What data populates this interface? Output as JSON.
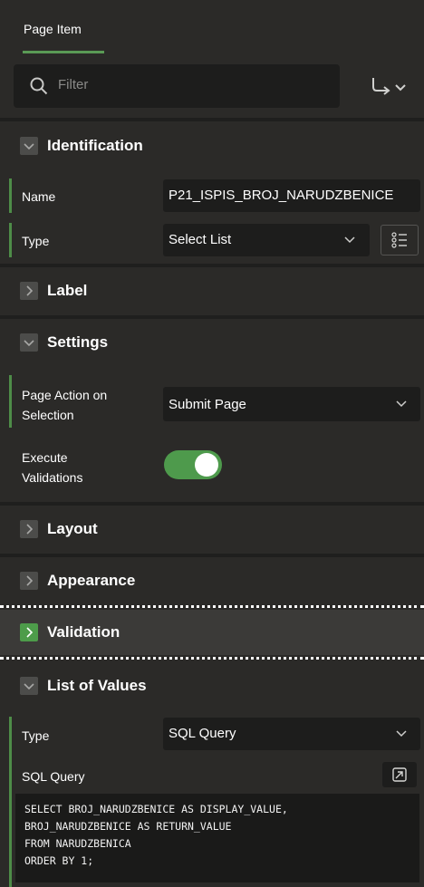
{
  "tab": {
    "label": "Page Item"
  },
  "search": {
    "placeholder": "Filter"
  },
  "sections": {
    "identification": {
      "title": "Identification",
      "name_label": "Name",
      "name_value": "P21_ISPIS_BROJ_NARUDZBENICE",
      "type_label": "Type",
      "type_value": "Select List"
    },
    "label": {
      "title": "Label"
    },
    "settings": {
      "title": "Settings",
      "page_action_label_1": "Page Action on",
      "page_action_label_2": "Selection",
      "page_action_value": "Submit Page",
      "execute_label_1": "Execute",
      "execute_label_2": "Validations",
      "execute_validations_on": true
    },
    "layout": {
      "title": "Layout"
    },
    "appearance": {
      "title": "Appearance"
    },
    "validation": {
      "title": "Validation"
    },
    "lov": {
      "title": "List of Values",
      "type_label": "Type",
      "type_value": "SQL Query",
      "sql_label": "SQL Query",
      "sql_lines": [
        "SELECT BROJ_NARUDZBENICE AS DISPLAY_VALUE,",
        "BROJ_NARUDZBENICE AS RETURN_VALUE",
        "FROM NARUDZBENICA",
        "ORDER BY 1;"
      ]
    }
  },
  "colors": {
    "accent": "#4e9a4c",
    "panel": "#2b2a28",
    "field": "#1d1d1c"
  }
}
